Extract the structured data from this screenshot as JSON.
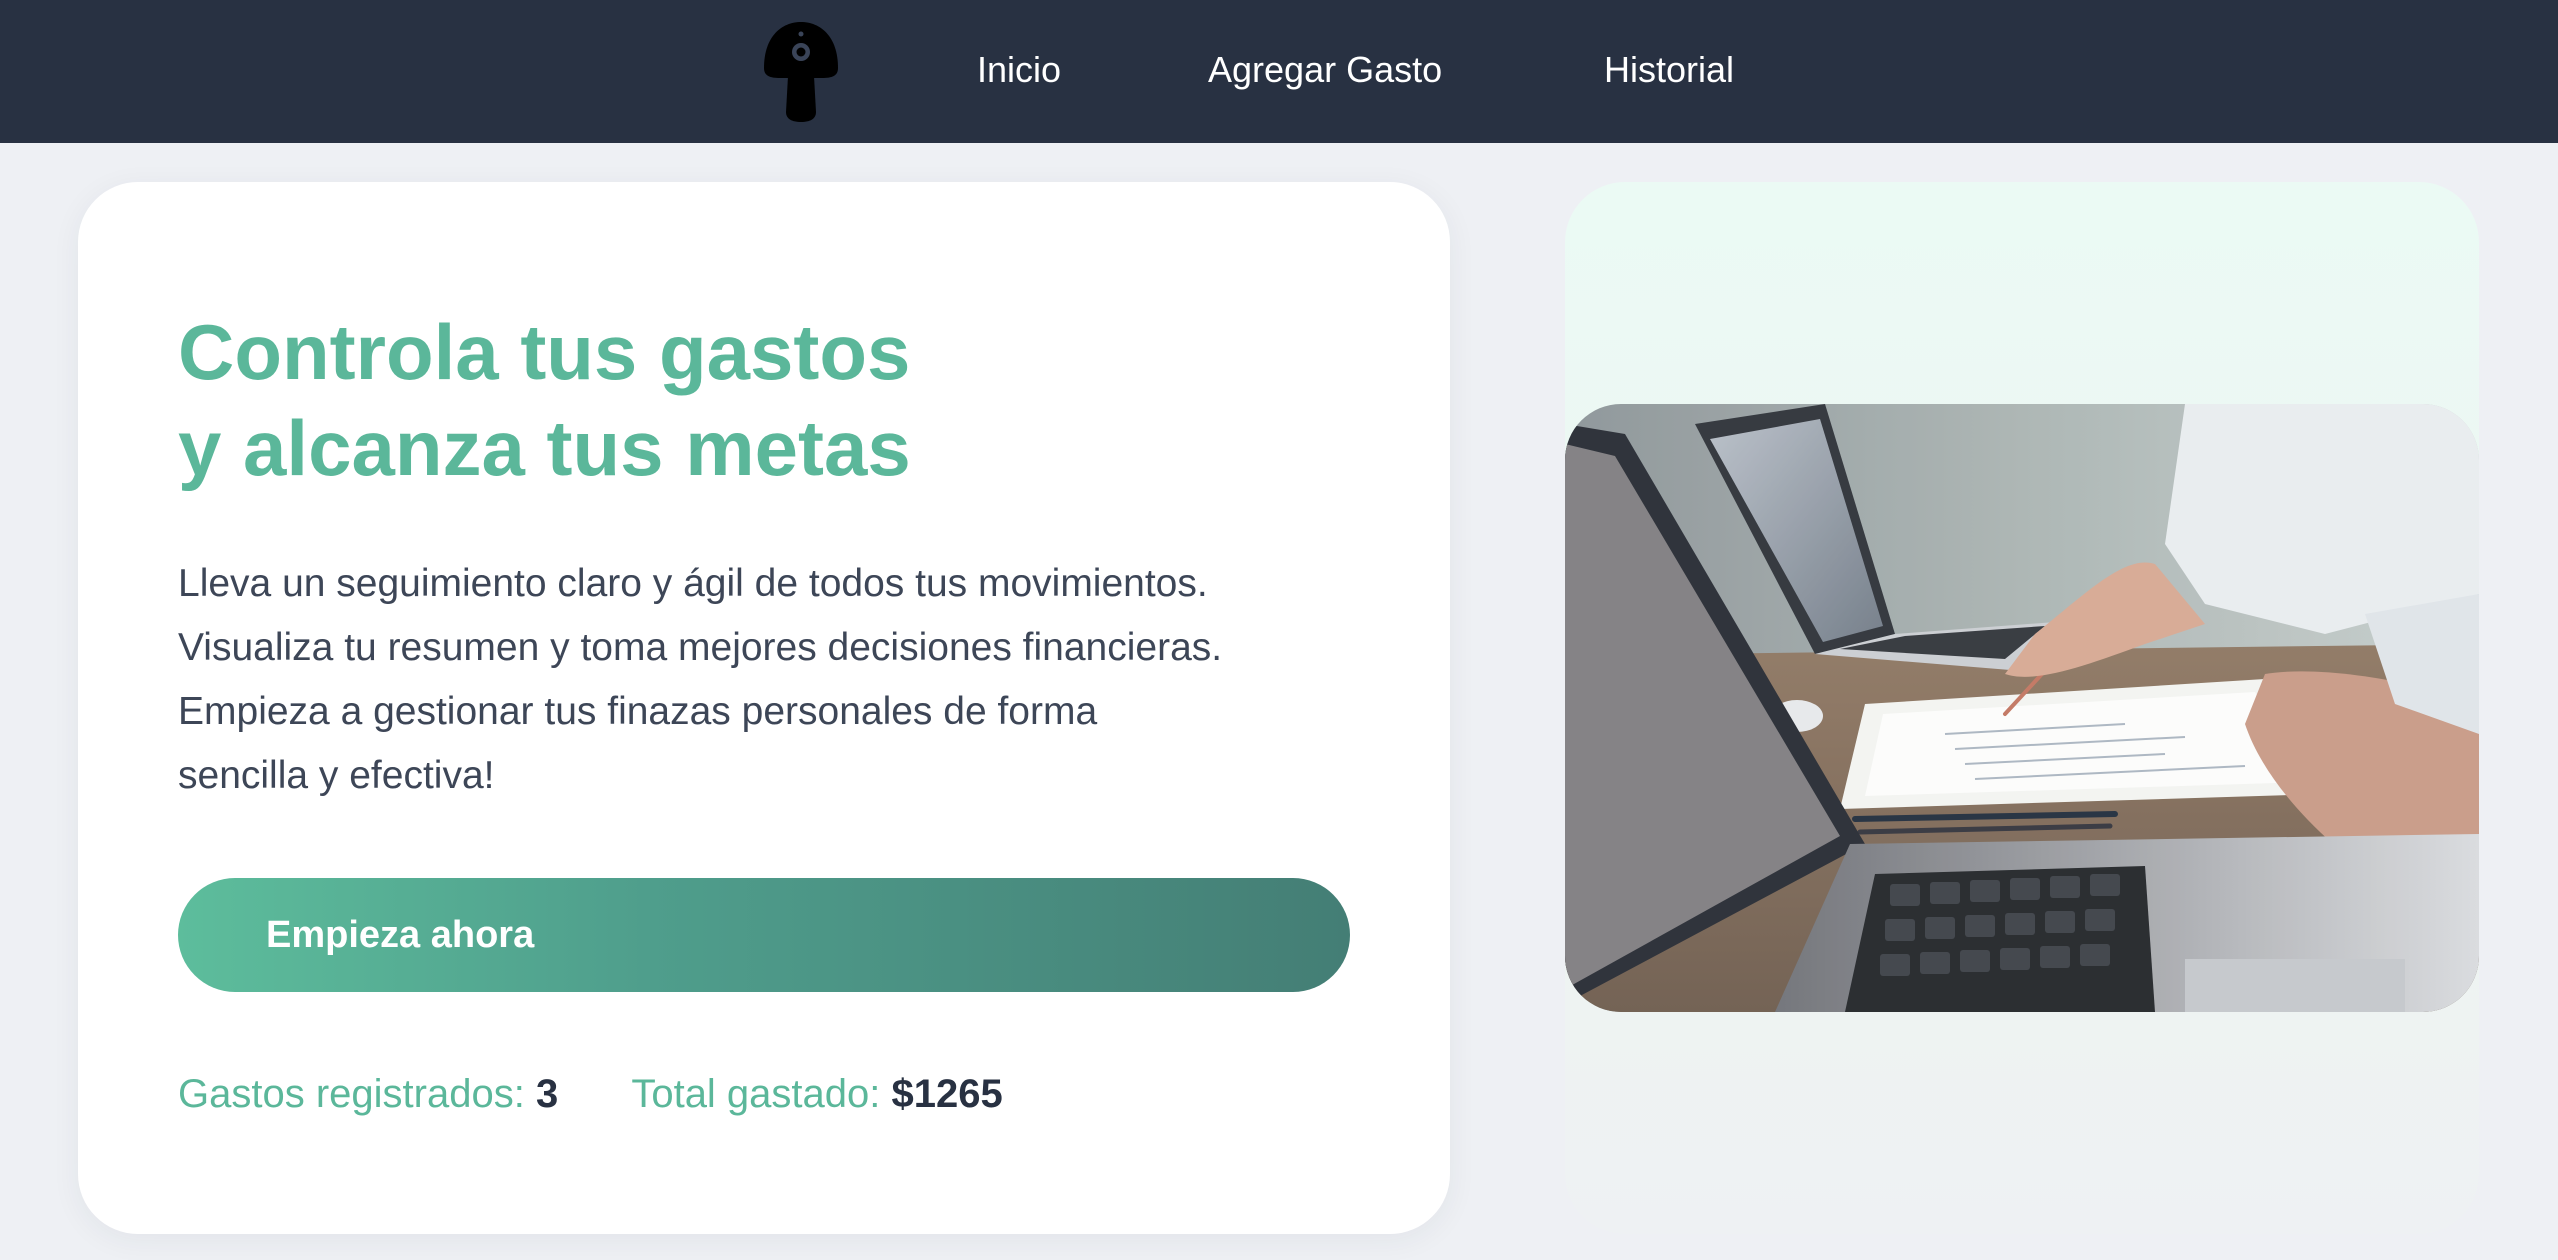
{
  "navbar": {
    "logo_icon": "mushroom-logo-icon",
    "links": [
      {
        "label": "Inicio"
      },
      {
        "label": "Agregar Gasto"
      },
      {
        "label": "Historial"
      }
    ],
    "background_color": "#283142"
  },
  "hero": {
    "headline_line1": "Controla tus gastos",
    "headline_line2": "y alcanza tus metas",
    "description_lines": [
      "Lleva un seguimiento claro y ágil de todos tus movimientos.",
      "Visualiza tu resumen y toma mejores decisiones financieras.",
      "Empieza a gestionar tus finazas personales de forma",
      "sencilla y efectiva!"
    ],
    "cta_label": "Empieza ahora",
    "accent_color": "#5bb79a"
  },
  "stats": {
    "expenses_label": "Gastos registrados:",
    "expenses_value": "3",
    "total_label": "Total gastado:",
    "total_value": "$1265"
  },
  "image": {
    "subject": "people-working-with-laptops-and-documents-photo"
  }
}
